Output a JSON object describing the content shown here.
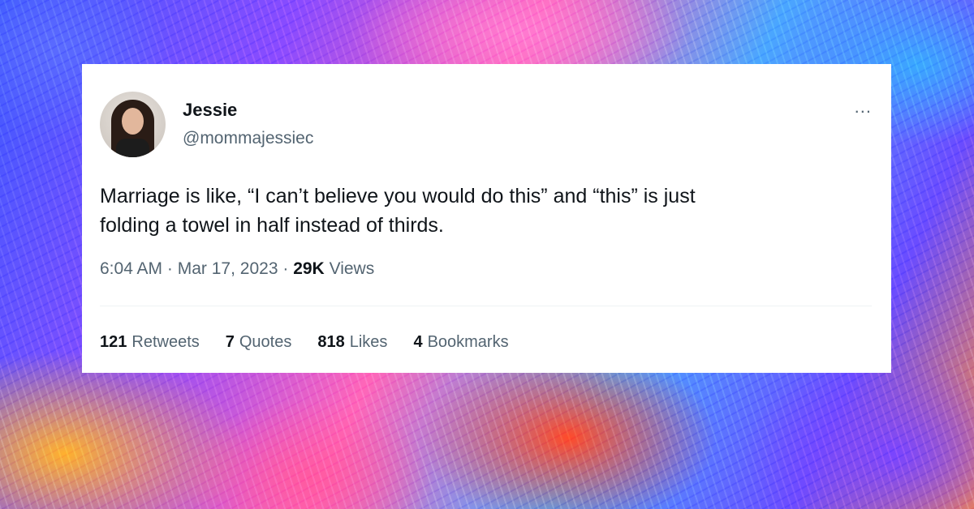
{
  "tweet": {
    "author_name": "Jessie",
    "author_handle": "@mommajessiec",
    "more_icon": "...",
    "text_line1": "Marriage is like, “I can’t believe you would do this” and “this” is just",
    "text_line2": "folding a towel in half instead of thirds.",
    "time": "6:04 AM",
    "separator": "·",
    "date": "Mar 17, 2023",
    "views_count": "29K",
    "views_label": "Views"
  },
  "stats": [
    {
      "count": "121",
      "label": "Retweets"
    },
    {
      "count": "7",
      "label": "Quotes"
    },
    {
      "count": "818",
      "label": "Likes"
    },
    {
      "count": "4",
      "label": "Bookmarks"
    }
  ],
  "colors": {
    "card_bg": "#ffffff",
    "primary_text": "#0f1419",
    "secondary_text": "#536471",
    "divider": "#eff3f4"
  }
}
